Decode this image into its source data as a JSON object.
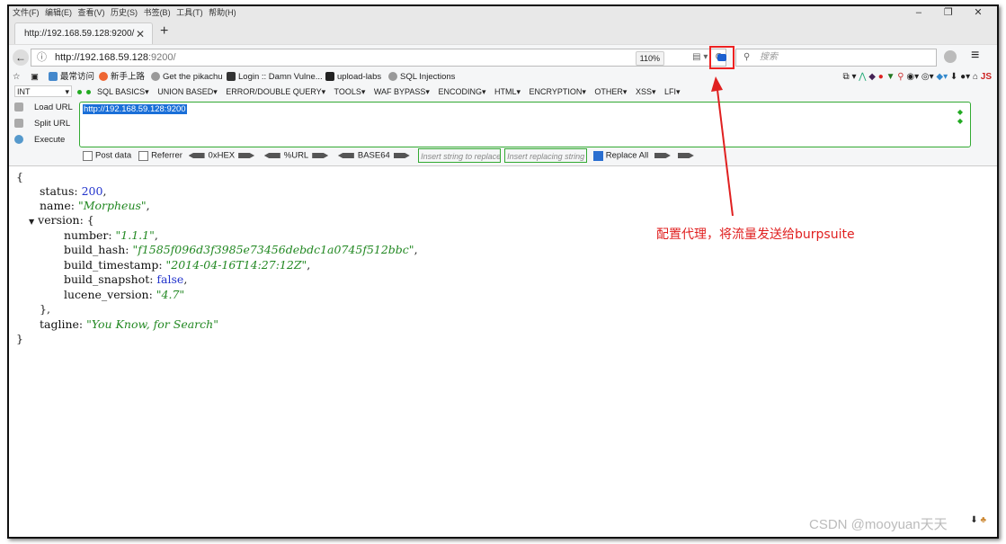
{
  "menubar": {
    "items": [
      "文件(F)",
      "编辑(E)",
      "查看(V)",
      "历史(S)",
      "书签(B)",
      "工具(T)",
      "帮助(H)"
    ]
  },
  "tab": {
    "title": "http://192.168.59.128:9200/",
    "close": "✕",
    "new": "+"
  },
  "navbar": {
    "url_host": "http://192.168.59.128",
    "url_rest": ":9200/",
    "zoom": "110%",
    "reload": "C",
    "search_placeholder": "搜索"
  },
  "bookmarks": [
    "最常访问",
    "新手上路",
    "Get the pikachu",
    "Login :: Damn Vulne...",
    "upload-labs",
    "SQL Injections"
  ],
  "hackbar": {
    "select": "INT",
    "menus": [
      "SQL BASICS▾",
      "UNION BASED▾",
      "ERROR/DOUBLE QUERY▾",
      "TOOLS▾",
      "WAF BYPASS▾",
      "ENCODING▾",
      "HTML▾",
      "ENCRYPTION▾",
      "OTHER▾",
      "XSS▾",
      "LFI▾"
    ],
    "load_url": "Load URL",
    "split_url": "Split URL",
    "execute": "Execute",
    "textarea_value": "http://192.168.59.128:9200",
    "post_data": "Post data",
    "referrer": "Referrer",
    "hex": "0xHEX",
    "url_enc": "%URL",
    "base64": "BASE64",
    "insert_placeholder": "Insert string to replace",
    "replacing_placeholder": "Insert replacing string",
    "replace_all": "Replace All"
  },
  "json_view": {
    "open_brace": "{",
    "status_key": "status",
    "status_val": "200",
    "name_key": "name",
    "name_val": "\"Morpheus\"",
    "version_key": "version",
    "number_key": "number",
    "number_val": "\"1.1.1\"",
    "build_hash_key": "build_hash",
    "build_hash_val": "\"f1585f096d3f3985e73456debdc1a0745f512bbc\"",
    "build_timestamp_key": "build_timestamp",
    "build_timestamp_val": "\"2014-04-16T14:27:12Z\"",
    "build_snapshot_key": "build_snapshot",
    "build_snapshot_val": "false",
    "lucene_version_key": "lucene_version",
    "lucene_version_val": "\"4.7\"",
    "tagline_key": "tagline",
    "tagline_val": "\"You Know, for Search\"",
    "close_brace": "}"
  },
  "annotation": "配置代理，将流量发送给burpsuite",
  "watermark": "CSDN @mooyuan天天",
  "colors": {
    "highlight": "#e02020",
    "hackbar_border": "#33aa33",
    "selection": "#1a6fd8"
  }
}
